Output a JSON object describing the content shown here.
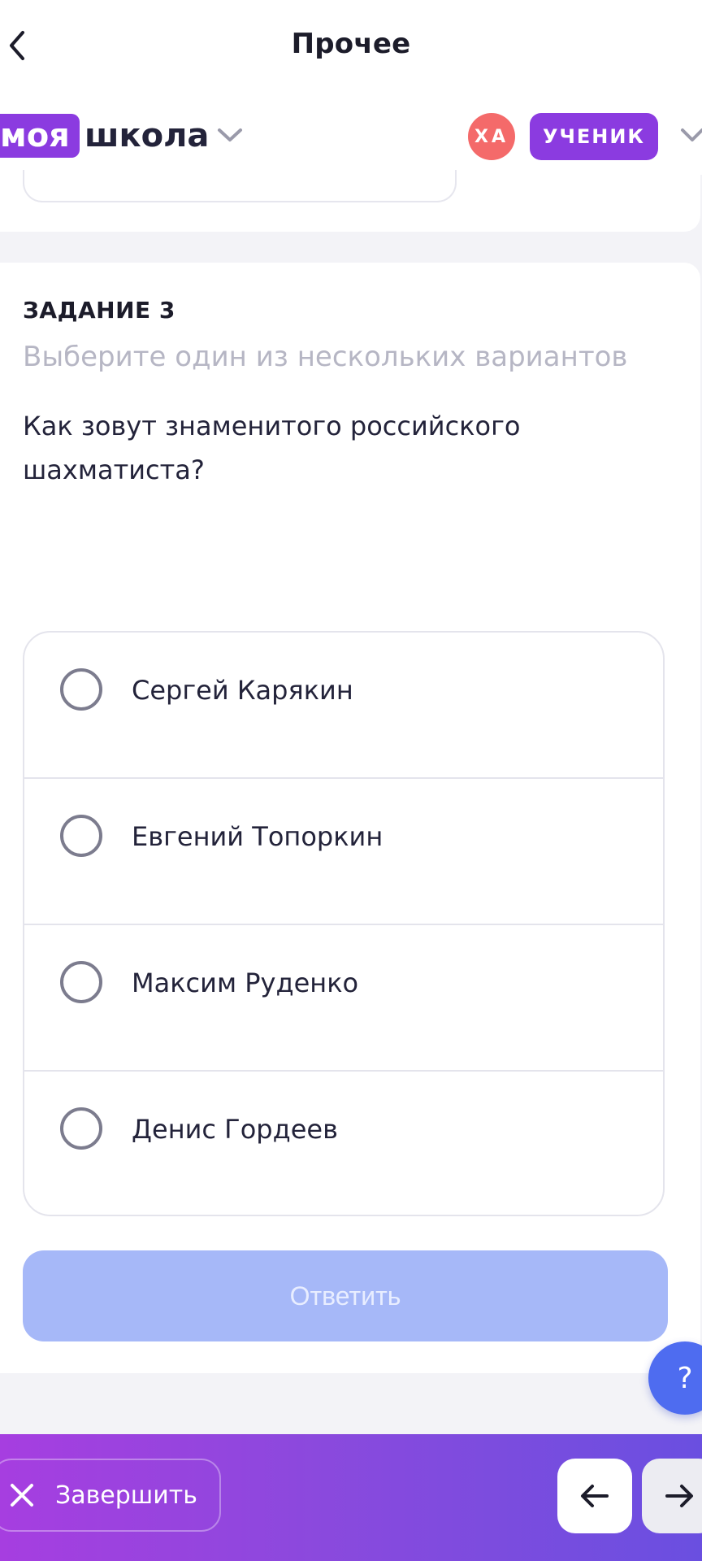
{
  "nav": {
    "title": "Прочее",
    "back_icon": "chevron-left-icon"
  },
  "header": {
    "logo_part1": "моя",
    "logo_part2": "школа",
    "avatar_initials": "ХА",
    "role": "УЧЕНИК",
    "colors": {
      "brand": "#8b3be0",
      "avatar": "#f46a6a"
    }
  },
  "task": {
    "label": "ЗАДАНИЕ 3",
    "hint": "Выберите один из нескольких вариантов",
    "question": "Как зовут знаменитого российского шахматиста?",
    "options": [
      {
        "label": "Сергей Карякин",
        "selected": false
      },
      {
        "label": "Евгений Топоркин",
        "selected": false
      },
      {
        "label": "Максим Руденко",
        "selected": false
      },
      {
        "label": "Денис Гордеев",
        "selected": false
      }
    ],
    "answer_label": "Ответить"
  },
  "help": {
    "label": "?"
  },
  "bottom": {
    "finish_label": "Завершить",
    "prev_icon": "arrow-left-icon",
    "next_icon": "arrow-right-icon"
  }
}
